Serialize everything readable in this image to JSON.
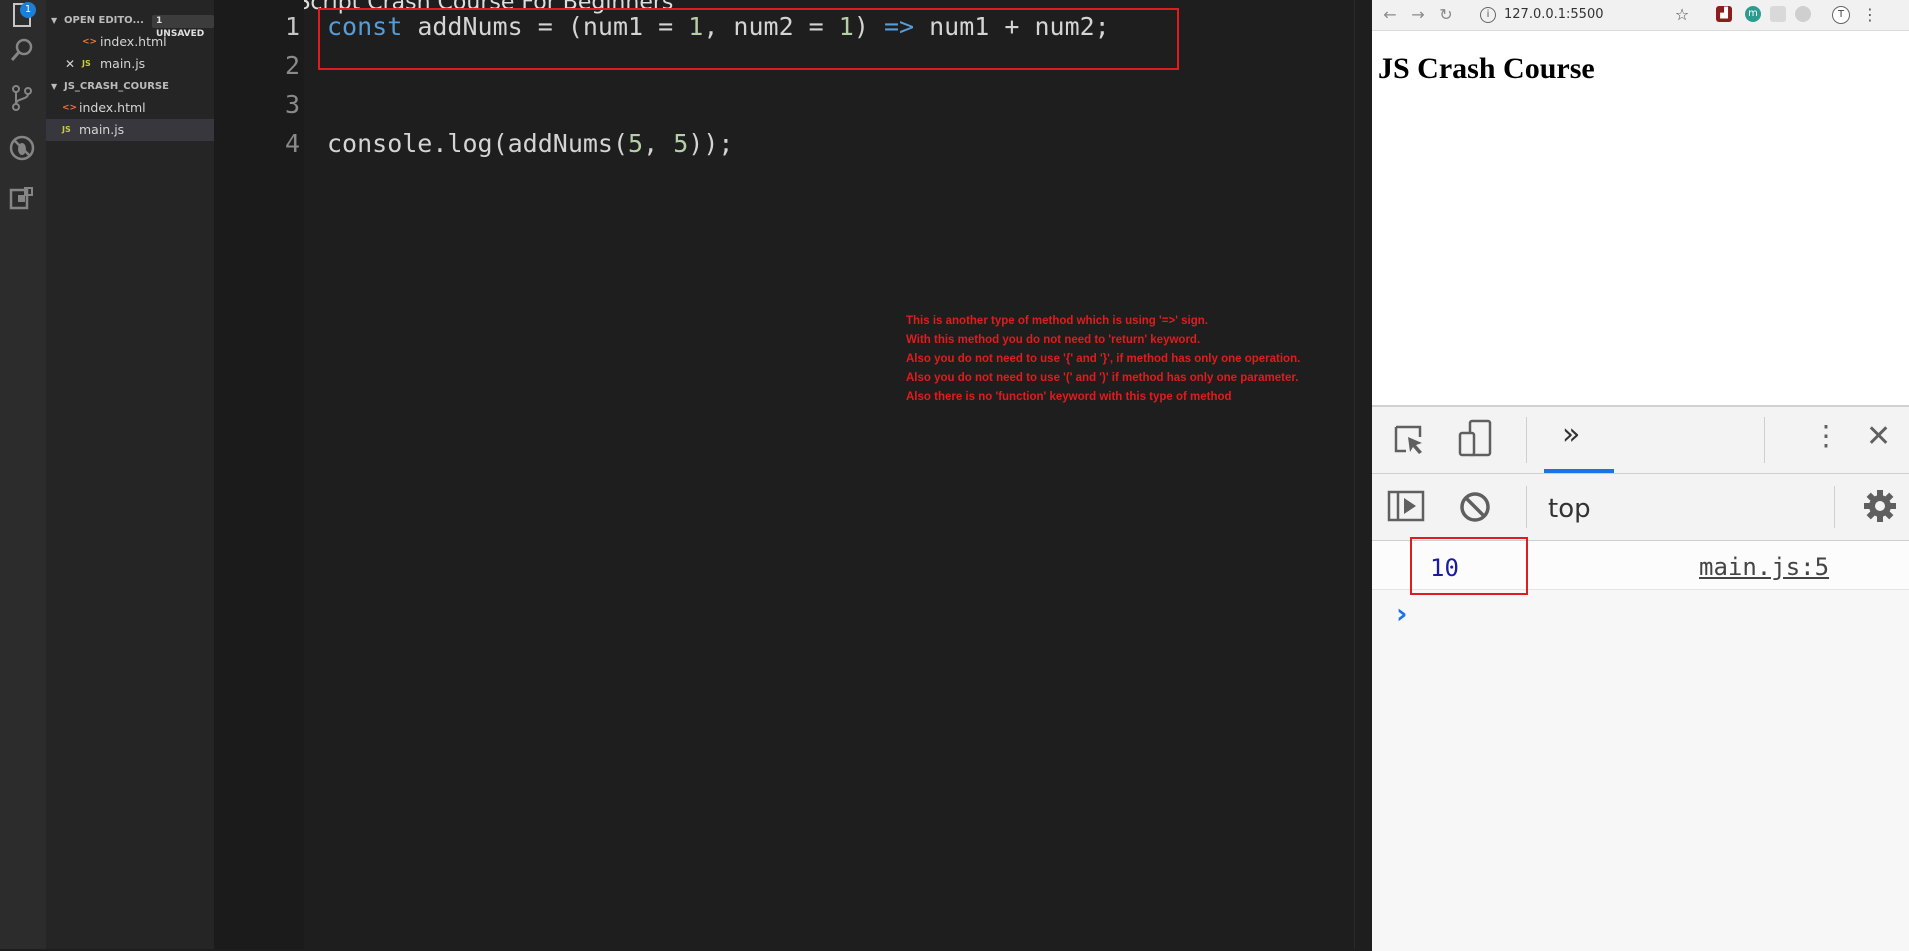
{
  "video_title_fragment": "JavaScript Crash Course For Beginners",
  "activity_bar": {
    "explorer_badge": "1"
  },
  "explorer": {
    "open_editors_title": "OPEN EDITO...",
    "unsaved_badge": "1 UNSAVED",
    "open_editors": [
      {
        "name": "index.html",
        "icon": "<>"
      },
      {
        "name": "main.js",
        "icon": "JS"
      }
    ],
    "project_title": "JS_CRASH_COURSE",
    "project_files": [
      {
        "name": "index.html",
        "icon": "<>"
      },
      {
        "name": "main.js",
        "icon": "JS"
      }
    ]
  },
  "editor": {
    "line_numbers": [
      "1",
      "2",
      "3",
      "4"
    ],
    "line1": {
      "kw_const": "const",
      "t1": " addNums = (num1 = ",
      "n1": "1",
      "t2": ", num2 = ",
      "n2": "1",
      "t3": ") ",
      "arrow": "=>",
      "t4": " num1 + num2;"
    },
    "line4": {
      "t1": "console.log(addNums(",
      "n1": "5",
      "t2": ", ",
      "n2": "5",
      "t3": "));"
    },
    "notes": [
      "This is another type of method which is using '=>' sign.",
      "With this method you do not need to 'return' keyword.",
      "Also you do not need to use '{' and '}', if method has only one operation.",
      "Also you do not need to use '(' and ')' if method has only one parameter.",
      "Also there is no 'function' keyword with this type of method"
    ]
  },
  "browser": {
    "url": "127.0.0.1:5500",
    "page_heading": "JS Crash Course",
    "devtools": {
      "context": "top",
      "log_value": "10",
      "log_source": "main.js:5"
    }
  },
  "colors": {
    "annotation_red": "#e11c1c",
    "keyword_blue": "#569cd6",
    "number_green": "#b5cea8",
    "devtools_accent": "#1a73e8"
  }
}
